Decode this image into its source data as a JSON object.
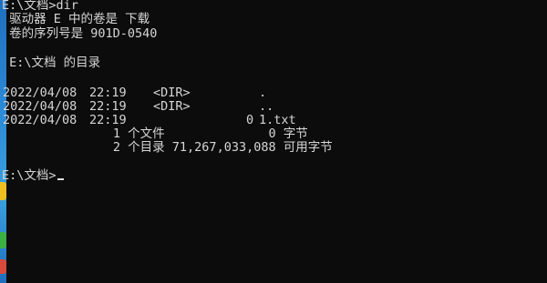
{
  "console": {
    "prompt_dir_command": "E:\\文档>dir",
    "volume_line": " 驱动器 E 中的卷是 下载",
    "serial_line": " 卷的序列号是 901D-0540",
    "directory_of": " E:\\文档 的目录",
    "entries": [
      {
        "date": "2022/04/08",
        "time": "22:19",
        "type": "<DIR>",
        "size": "",
        "name": "."
      },
      {
        "date": "2022/04/08",
        "time": "22:19",
        "type": "<DIR>",
        "size": "",
        "name": ".."
      },
      {
        "date": "2022/04/08",
        "time": "22:19",
        "type": "",
        "size": "0",
        "name": "1.txt"
      }
    ],
    "summary_files": "               1 个文件              0 字节",
    "summary_dirs": "               2 个目录 71,267,033,088 可用字节",
    "final_prompt": "E:\\文档>"
  },
  "colors": {
    "background": "#0c0c0c",
    "text": "#d6d6d6",
    "taskbar_edge": "#2c8ad6"
  }
}
